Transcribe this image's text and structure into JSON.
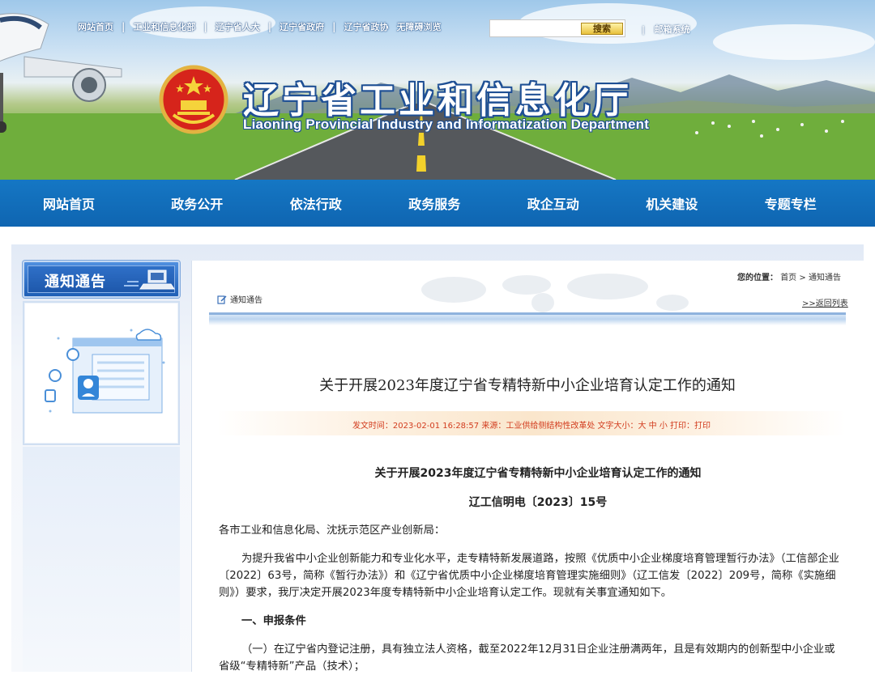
{
  "header": {
    "top_links": [
      "网站首页",
      "工业和信息化部",
      "辽宁省人大",
      "辽宁省政府",
      "辽宁省政协",
      "无障碍浏览"
    ],
    "search": {
      "placeholder": "",
      "button_label": "搜索"
    },
    "mail_link": "邮箱系统",
    "site_title": "辽宁省工业和信息化厅",
    "site_subtitle": "Liaoning Provincial Industry and Informatization Department"
  },
  "nav": {
    "items": [
      "网站首页",
      "政务公开",
      "依法行政",
      "政务服务",
      "政企互动",
      "机关建设",
      "专题专栏"
    ]
  },
  "sidebar": {
    "title": "通知通告"
  },
  "breadcrumb": {
    "label": "您的位置：",
    "home": "首页",
    "sep": ">",
    "current": "通知通告"
  },
  "column": {
    "title": "通知通告",
    "back_link": ">>返回列表"
  },
  "article": {
    "title": "关于开展2023年度辽宁省专精特新中小企业培育认定工作的通知",
    "meta": "发文时间：2023-02-01 16:28:57 来源：工业供给侧结构性改革处 文字大小：大 中 小     打印：打印",
    "doc_title": "关于开展2023年度辽宁省专精特新中小企业培育认定工作的通知",
    "doc_no": "辽工信明电〔2023〕15号",
    "salutation": "各市工业和信息化局、沈抚示范区产业创新局：",
    "para1": "为提升我省中小企业创新能力和专业化水平，走专精特新发展道路，按照《优质中小企业梯度培育管理暂行办法》（工信部企业〔2022〕63号，简称《暂行办法》）和《辽宁省优质中小企业梯度培育管理实施细则》（辽工信发〔2022〕209号，简称《实施细则》）要求，我厅决定开展2023年度专精特新中小企业培育认定工作。现就有关事宜通知如下。",
    "heading1": "一、申报条件",
    "para2": "（一）在辽宁省内登记注册，具有独立法人资格，截至2022年12月31日企业注册满两年，且是有效期内的创新型中小企业或省级“专精特新”产品（技术）；"
  },
  "colors": {
    "nav_blue": "#1577c4",
    "meta_red": "#d23c1e",
    "title_outline": "#1e4f94"
  },
  "icons": [
    "national-emblem-icon",
    "airplane-icon",
    "notice-board-icon",
    "edit-icon"
  ]
}
